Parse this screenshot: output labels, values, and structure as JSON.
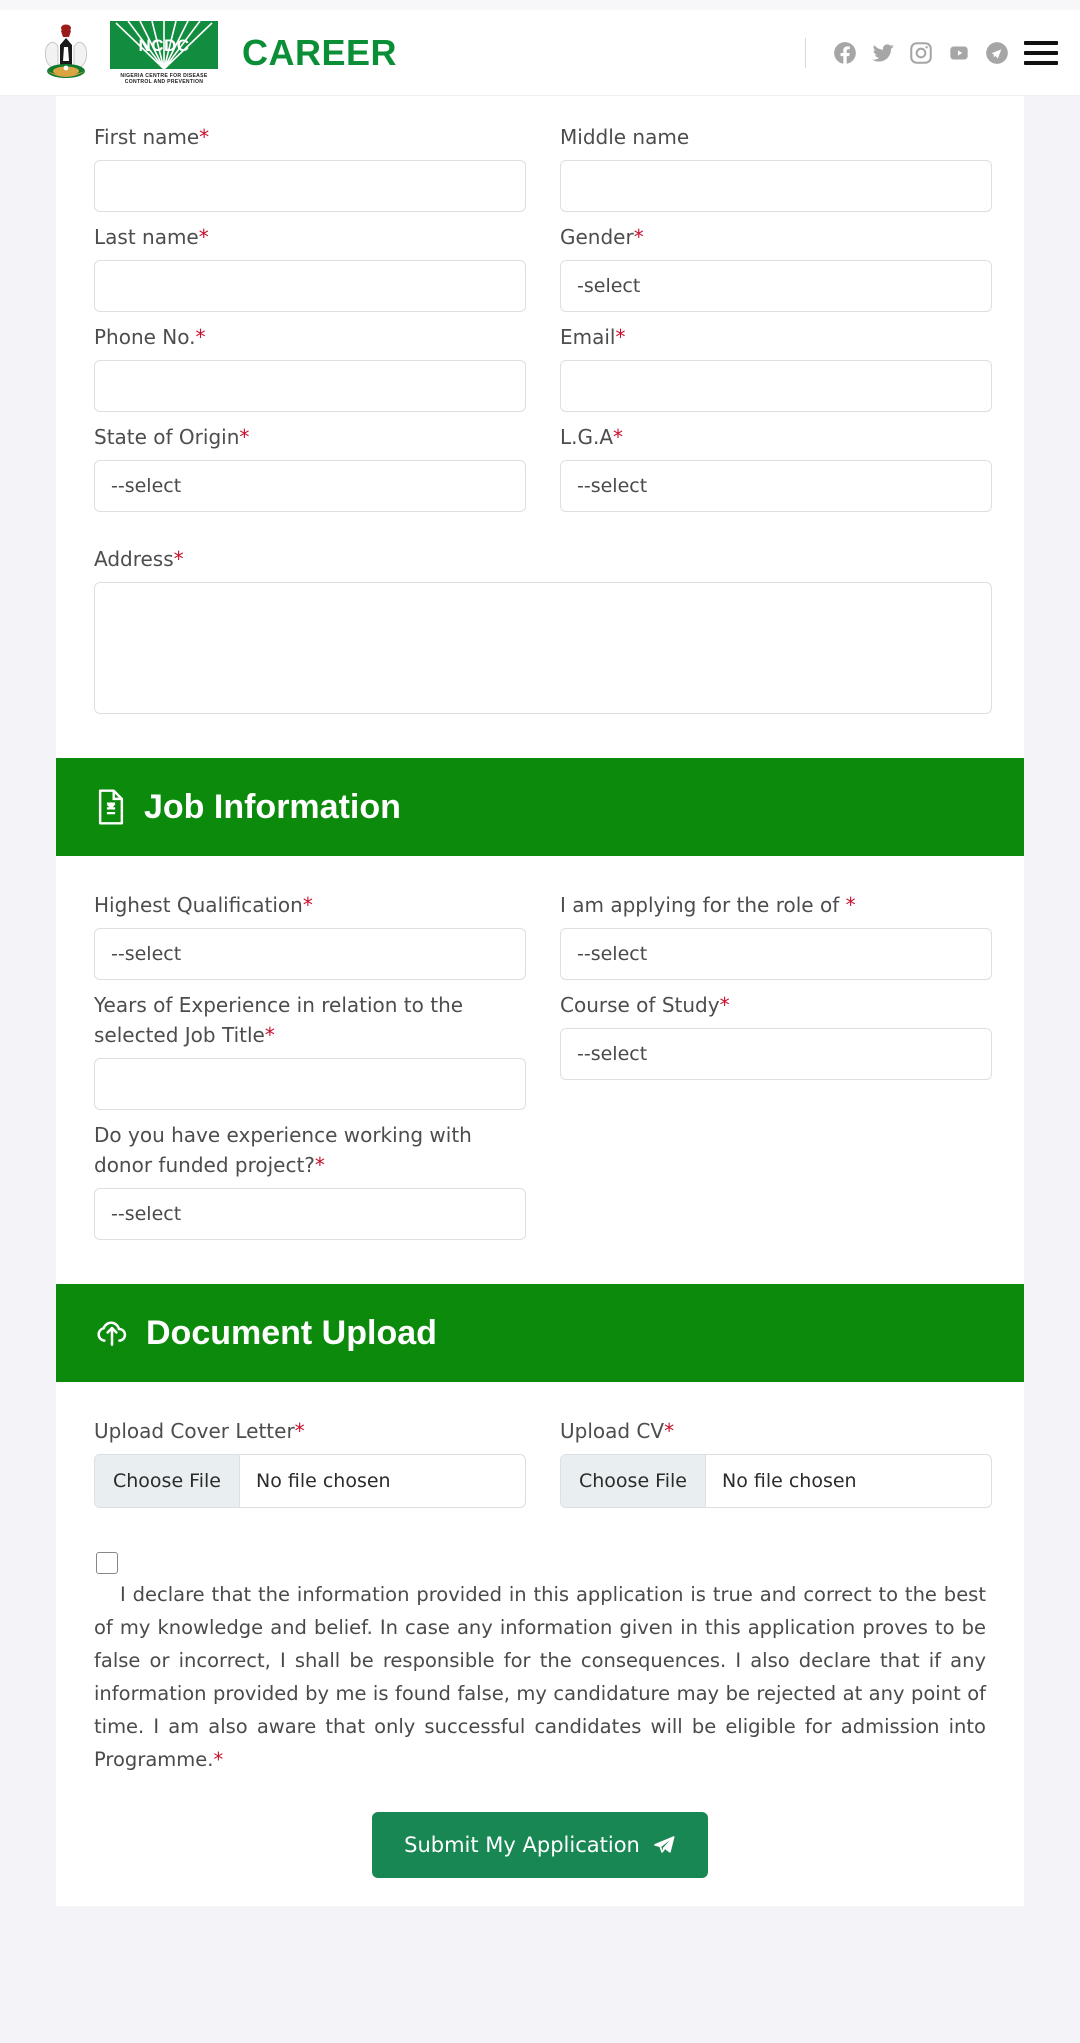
{
  "brand": {
    "logo_alt": "NCDC — Nigeria Centre for Disease Control and Prevention",
    "ncdc_mark": "NCDC",
    "ncdc_tagline_line1": "NIGERIA CENTRE FOR DISEASE",
    "ncdc_tagline_line2": "CONTROL AND PREVENTION",
    "career_word": "CAREER",
    "accent_green": "#0a8f36"
  },
  "header": {
    "social": [
      {
        "name": "facebook-icon",
        "label": "Facebook"
      },
      {
        "name": "twitter-icon",
        "label": "Twitter"
      },
      {
        "name": "instagram-icon",
        "label": "Instagram"
      },
      {
        "name": "youtube-icon",
        "label": "YouTube"
      },
      {
        "name": "telegram-icon",
        "label": "Telegram"
      }
    ],
    "menu_label": "Menu"
  },
  "personal": {
    "first_name": {
      "label": "First name",
      "required": true,
      "value": ""
    },
    "middle_name": {
      "label": "Middle name",
      "required": false,
      "value": ""
    },
    "last_name": {
      "label": "Last name",
      "required": true,
      "value": ""
    },
    "gender": {
      "label": "Gender",
      "required": true,
      "value": "-select"
    },
    "phone": {
      "label": "Phone No.",
      "required": true,
      "value": ""
    },
    "email": {
      "label": "Email",
      "required": true,
      "value": ""
    },
    "state_of_origin": {
      "label": "State of Origin",
      "required": true,
      "value": "--select"
    },
    "lga": {
      "label": "L.G.A",
      "required": true,
      "value": "--select"
    },
    "address": {
      "label": "Address",
      "required": true,
      "value": ""
    }
  },
  "job_section": {
    "title": "Job Information",
    "icon": "document-icon",
    "banner_color": "#0c8a0c",
    "highest_qualification": {
      "label": "Highest Qualification",
      "required": true,
      "value": "--select"
    },
    "role": {
      "label": "I am applying for the role of",
      "required": true,
      "value": "--select"
    },
    "years_experience": {
      "label": "Years of Experience in relation to the selected Job Title",
      "required": true,
      "value": ""
    },
    "course_of_study": {
      "label": "Course of Study",
      "required": true,
      "value": "--select"
    },
    "donor_funded": {
      "label": "Do you have experience working with donor funded project?",
      "required": true,
      "value": "--select"
    }
  },
  "upload_section": {
    "title": "Document Upload",
    "icon": "cloud-upload-icon",
    "banner_color": "#0c8a0c",
    "cover_letter": {
      "label": "Upload Cover Letter",
      "required": true,
      "button": "Choose File",
      "status": "No file chosen"
    },
    "cv": {
      "label": "Upload CV",
      "required": true,
      "button": "Choose File",
      "status": "No file chosen"
    }
  },
  "declaration": {
    "checked": false,
    "text": "I declare that the information provided in this application is true and correct to the best of my knowledge and belief. In case any information given in this application proves to be false or incorrect, I shall be responsible for the consequences. I also declare that if any information provided by me is found false, my candidature may be rejected at any point of time. I am also aware that only successful candidates will be eligible for admission into Programme.",
    "required_mark": "*"
  },
  "submit": {
    "label": "Submit My Application",
    "icon": "paper-plane-icon",
    "color": "#198754"
  },
  "required_mark": "*"
}
